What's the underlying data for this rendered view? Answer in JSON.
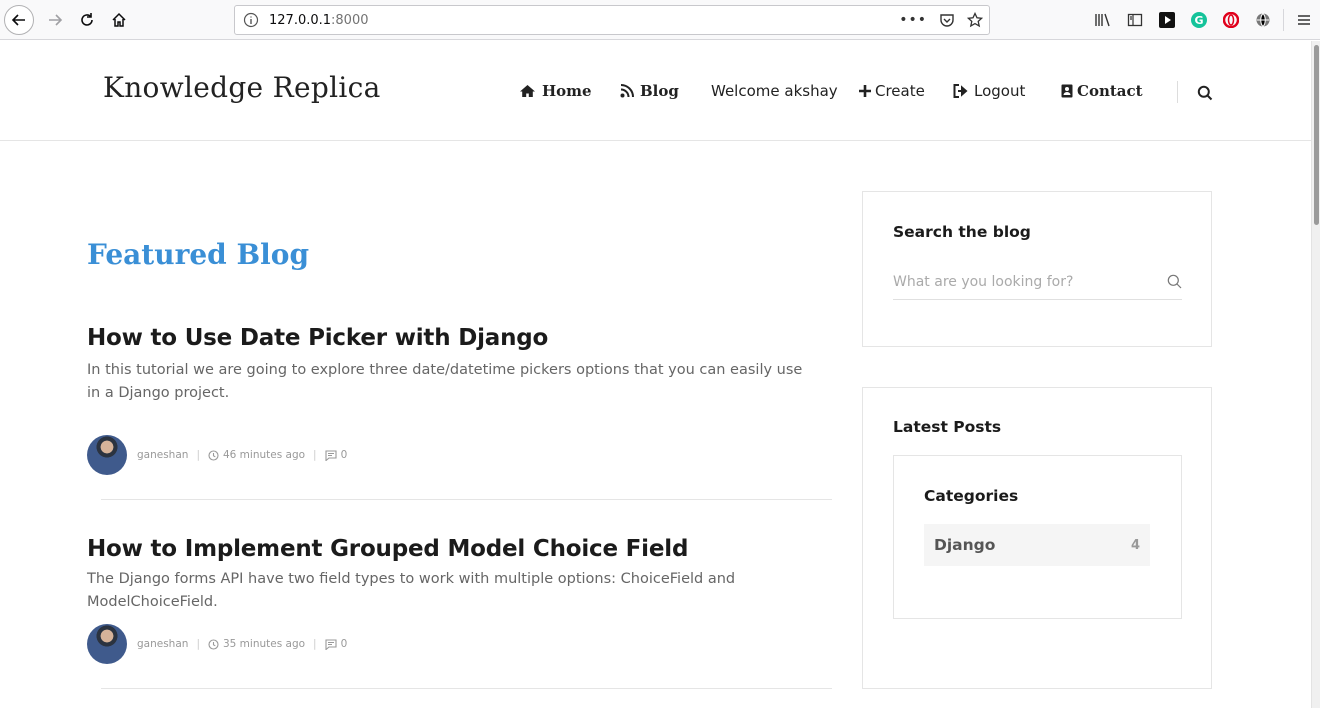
{
  "browser": {
    "url_host": "127.0.0.1",
    "url_port": ":8000"
  },
  "site": {
    "logo": "Knowledge Replica",
    "nav": {
      "home": "Home",
      "blog": "Blog",
      "welcome": "Welcome akshay",
      "create": "Create",
      "logout": "Logout",
      "contact": "Contact"
    }
  },
  "main": {
    "featured_title": "Featured Blog",
    "posts": [
      {
        "title": "How to Use Date Picker with Django",
        "excerpt": "In this tutorial we are going to explore three date/datetime pickers options that you can easily use in a Django project.",
        "author": "ganeshan",
        "time": "46 minutes ago",
        "comments": "0"
      },
      {
        "title": "How to Implement Grouped Model Choice Field",
        "excerpt": "The Django forms API have two field types to work with multiple options: ChoiceField and ModelChoiceField.",
        "author": "ganeshan",
        "time": "35 minutes ago",
        "comments": "0"
      }
    ]
  },
  "sidebar": {
    "search": {
      "title": "Search the blog",
      "placeholder": "What are you looking for?"
    },
    "latest": {
      "title": "Latest Posts",
      "categories_title": "Categories",
      "categories": [
        {
          "name": "Django",
          "count": "4"
        }
      ]
    }
  },
  "colors": {
    "accent": "#3a8fd6",
    "heading": "#1b1b1b",
    "muted": "#999999"
  }
}
